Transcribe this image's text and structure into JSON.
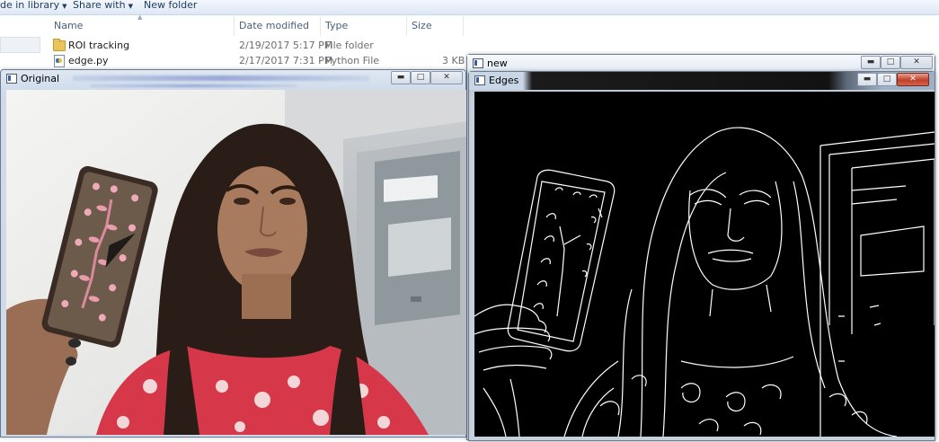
{
  "explorer": {
    "toolbar": {
      "include_label": "de in library",
      "share_label": "Share with",
      "new_folder_label": "New folder"
    },
    "columns": {
      "name": "Name",
      "date": "Date modified",
      "type": "Type",
      "size": "Size"
    },
    "rows": [
      {
        "name": "ROI tracking",
        "date": "2/19/2017 5:17 PM",
        "type": "File folder",
        "size": "",
        "icon": "folder-icon"
      },
      {
        "name": "edge.py",
        "date": "2/17/2017 7:31 PM",
        "type": "Python File",
        "size": "3 KB",
        "icon": "python-file-icon"
      }
    ]
  },
  "windows": {
    "original": {
      "title": "Original"
    },
    "new": {
      "title": "new"
    },
    "edges": {
      "title": "Edges"
    }
  },
  "caption_glyphs": {
    "minimize": "▬",
    "maximize": "□",
    "close": "✕"
  },
  "colors": {
    "edges_background": "#000000",
    "edge_lines": "#ffffff",
    "close_button": "#c0402b"
  }
}
